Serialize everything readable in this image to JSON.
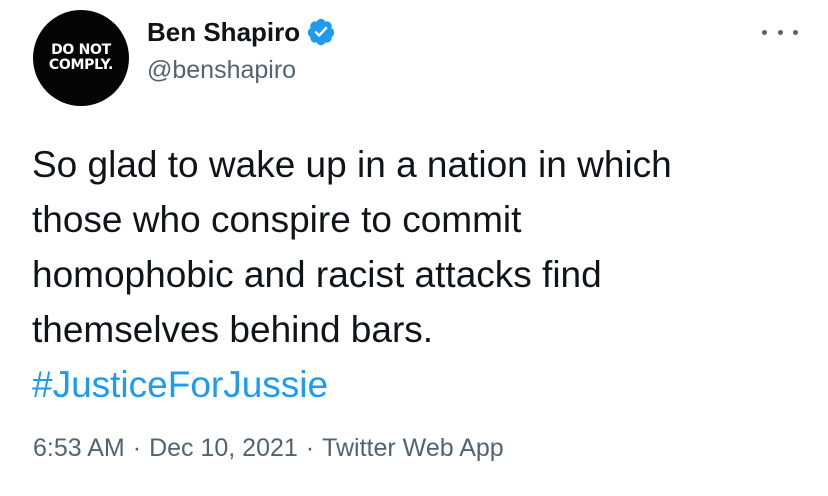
{
  "author": {
    "avatar_text": [
      "DO NOT",
      "COMPLY."
    ],
    "display_name": "Ben Shapiro",
    "handle": "@benshapiro",
    "verified": true,
    "verified_color": "#1d9bf0"
  },
  "tweet": {
    "text_lines": [
      "So glad to wake up in a nation in which",
      "those who conspire to commit",
      "homophobic and racist attacks find",
      "themselves behind bars."
    ],
    "hashtag": "#JusticeForJussie",
    "hashtag_color": "#1d9bf0"
  },
  "meta": {
    "time": "6:53 AM",
    "separator": "·",
    "date": "Dec 10, 2021",
    "source": "Twitter Web App"
  },
  "icons": {
    "more": "more-options-icon",
    "verified": "verified-badge-icon"
  }
}
